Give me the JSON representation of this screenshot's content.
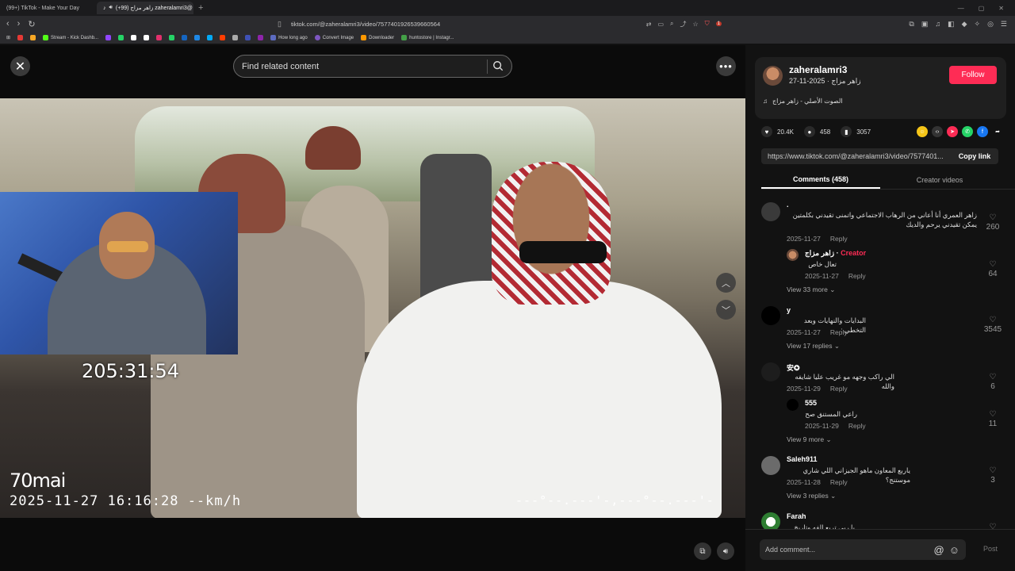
{
  "browser": {
    "tabs": [
      {
        "title": "(99+) TikTok - Make Your Day"
      },
      {
        "title": "زاهر مزاج (99+) zaheralamri3@"
      }
    ],
    "url": "tiktok.com/@zaheralamri3/video/7577401926539660564",
    "ext_badge": "1",
    "bookmarks": [
      {
        "label": "",
        "color": "#e53935"
      },
      {
        "label": "",
        "color": "#f9a825"
      },
      {
        "label": "Stream - Kick Dashb...",
        "color": "#53fc18"
      },
      {
        "label": "",
        "color": "#9146ff"
      },
      {
        "label": "",
        "color": "#25d366"
      },
      {
        "label": "",
        "color": "#ffffff"
      },
      {
        "label": "",
        "color": "#ffffff"
      },
      {
        "label": "",
        "color": "#e1306c"
      },
      {
        "label": "",
        "color": "#25d366"
      },
      {
        "label": "",
        "color": "#1565c0"
      },
      {
        "label": "",
        "color": "#1e88e5"
      },
      {
        "label": "",
        "color": "#03a9f4"
      },
      {
        "label": "",
        "color": "#ff3d00"
      },
      {
        "label": "",
        "color": "#aaaaaa"
      },
      {
        "label": "",
        "color": "#3f51b5"
      },
      {
        "label": "",
        "color": "#8e24aa"
      },
      {
        "label": "",
        "color": "#5c6bc0"
      },
      {
        "label": "How long ago",
        "color": "#5c6bc0"
      },
      {
        "label": "Convert Image",
        "color": "#7e57c2"
      },
      {
        "label": "Downloader",
        "color": "#ff9800"
      },
      {
        "label": "huntostore | Instagr...",
        "color": "#43a047"
      }
    ]
  },
  "player": {
    "search_placeholder": "Find related content",
    "timer": "205:31:54",
    "cam_brand": "70mai",
    "cam_stamp": "2025-11-27  16:16:28  --km/h",
    "cam_stamp_right": "---°--.---'-,---°--.---'-"
  },
  "side": {
    "author": {
      "username": "zaheralamri3",
      "subtitle": "زاهر مزاج · 2025-11-27",
      "follow_label": "Follow",
      "sound": "الصوت الأصلي - زاهر مزاج"
    },
    "stats": {
      "likes": "20.4K",
      "comments": "458",
      "saves": "3057"
    },
    "share_colors": [
      "#f5c518",
      "#333333",
      "#fe2c55",
      "#25d366",
      "#1877f2"
    ],
    "link": {
      "url": "https://www.tiktok.com/@zaheralamri3/video/7577401...",
      "copy_label": "Copy link"
    },
    "tabs": {
      "comments": "Comments (458)",
      "creator": "Creator videos"
    },
    "comments": [
      {
        "name": ".",
        "text": "زاهر العمري أنا أعاني من الرهاب الاجتماعي واتمنى تقيدني بكلمتين يمكن تقيدني يرحم والديك",
        "date": "2025-11-27",
        "reply": "Reply",
        "likes": "260"
      },
      {
        "name": "زاهر مزاج",
        "creator": "Creator",
        "text": "تعال خاص",
        "date": "2025-11-27",
        "reply": "Reply",
        "likes": "64"
      },
      {
        "view_more": "View 33 more"
      },
      {
        "name": "y",
        "text": "البدايات والنهايات وبعد التخطي :",
        "date": "2025-11-27",
        "reply": "Reply",
        "likes": "3545"
      },
      {
        "view_more": "View 17 replies"
      },
      {
        "name": "安✪",
        "text": "الي راكب وجهه مو غريب عليا شايفه والله",
        "date": "2025-11-29",
        "reply": "Reply",
        "likes": "6"
      },
      {
        "name": "555",
        "text": "راعي المستنق صح",
        "date": "2025-11-29",
        "reply": "Reply",
        "likes": "11"
      },
      {
        "view_more": "View 9 more"
      },
      {
        "name": "Saleh911",
        "text": "ياربع المعاون ماهو الجيزاني اللي شاري موستنج؟",
        "date": "2025-11-28",
        "reply": "Reply",
        "likes": "3"
      },
      {
        "view_more": "View 3 replies"
      },
      {
        "name": "Farah",
        "text": "يا ربي تربع الفه وتاريخ همه"
      }
    ],
    "add_placeholder": "Add comment...",
    "post_label": "Post"
  }
}
